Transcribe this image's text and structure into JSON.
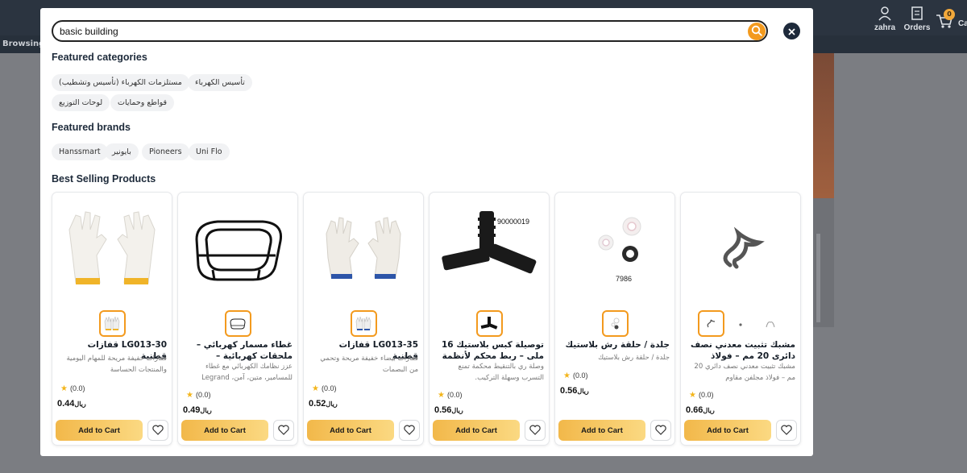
{
  "background": {
    "browsing_label": "Browsing H",
    "header": {
      "user_label": "zahra",
      "orders_label": "Orders",
      "cart_label": "Ca",
      "cart_count": "0"
    }
  },
  "search": {
    "value": "basic building",
    "placeholder": ""
  },
  "featured_categories": {
    "title": "Featured categories",
    "chips": [
      "تأسيس الكهرباء",
      "مستلزمات الكهرباء (تأسيس وتشطيب)",
      "لوحات التوزيع",
      "قواطع وحمايات"
    ]
  },
  "featured_brands": {
    "title": "Featured brands",
    "chips": [
      "Hanssmart",
      "بايونير",
      "Pioneers",
      "Uni Flo"
    ]
  },
  "best_selling": {
    "title": "Best Selling Products",
    "add_to_cart_label": "Add to Cart",
    "products": [
      {
        "title": "LG013-30 قفازات قطنية",
        "desc": "قفازات خفيفة مريحة للمهام اليومية والمنتجات الحساسة",
        "rating": "(0.0)",
        "price": "0.44",
        "currency": "ريال"
      },
      {
        "title": "غطاء مسمار كهربائي – ملحقات كهربائية – تشطيب",
        "desc": "عزز نظامك الكهربائي مع غطاء للمسامير، متين، آمن، Legrand",
        "rating": "(0.0)",
        "price": "0.49",
        "currency": "ريال"
      },
      {
        "title": "LG013-35 قفازات قطنية",
        "desc": "قفازات بيضاء خفيفة مريحة وتحمي من البصمات",
        "rating": "(0.0)",
        "price": "0.52",
        "currency": "ريال"
      },
      {
        "title": "توصيلة كبس بلاستيك 16 ملى – ربط محكم لأنظمة",
        "desc": "وصلة ري بالتنقيط محكمة تمنع التسرب وسهلة التركيب.",
        "rating": "(0.0)",
        "price": "0.56",
        "currency": "ريال",
        "image_label": "90000019"
      },
      {
        "title": "جلدة / حلقة رش بلاستيك",
        "desc": "جلدة / حلقة رش بلاستيك",
        "rating": "(0.0)",
        "price": "0.56",
        "currency": "ريال",
        "image_label": "7986"
      },
      {
        "title": "مشبك تثبيت معدني نصف دائرى 20 مم – فولاذ",
        "desc": "مشبك تثبيت معدني نصف دائري 20 مم – فولاذ مجلفن مقاوم",
        "rating": "(0.0)",
        "price": "0.66",
        "currency": "ريال"
      }
    ]
  },
  "colors": {
    "accent": "#f39a1e",
    "close_button": "#1e2a3b",
    "star": "#f3b51b",
    "cart_button_gradient": [
      "#f2b84a",
      "#fbd982"
    ]
  }
}
